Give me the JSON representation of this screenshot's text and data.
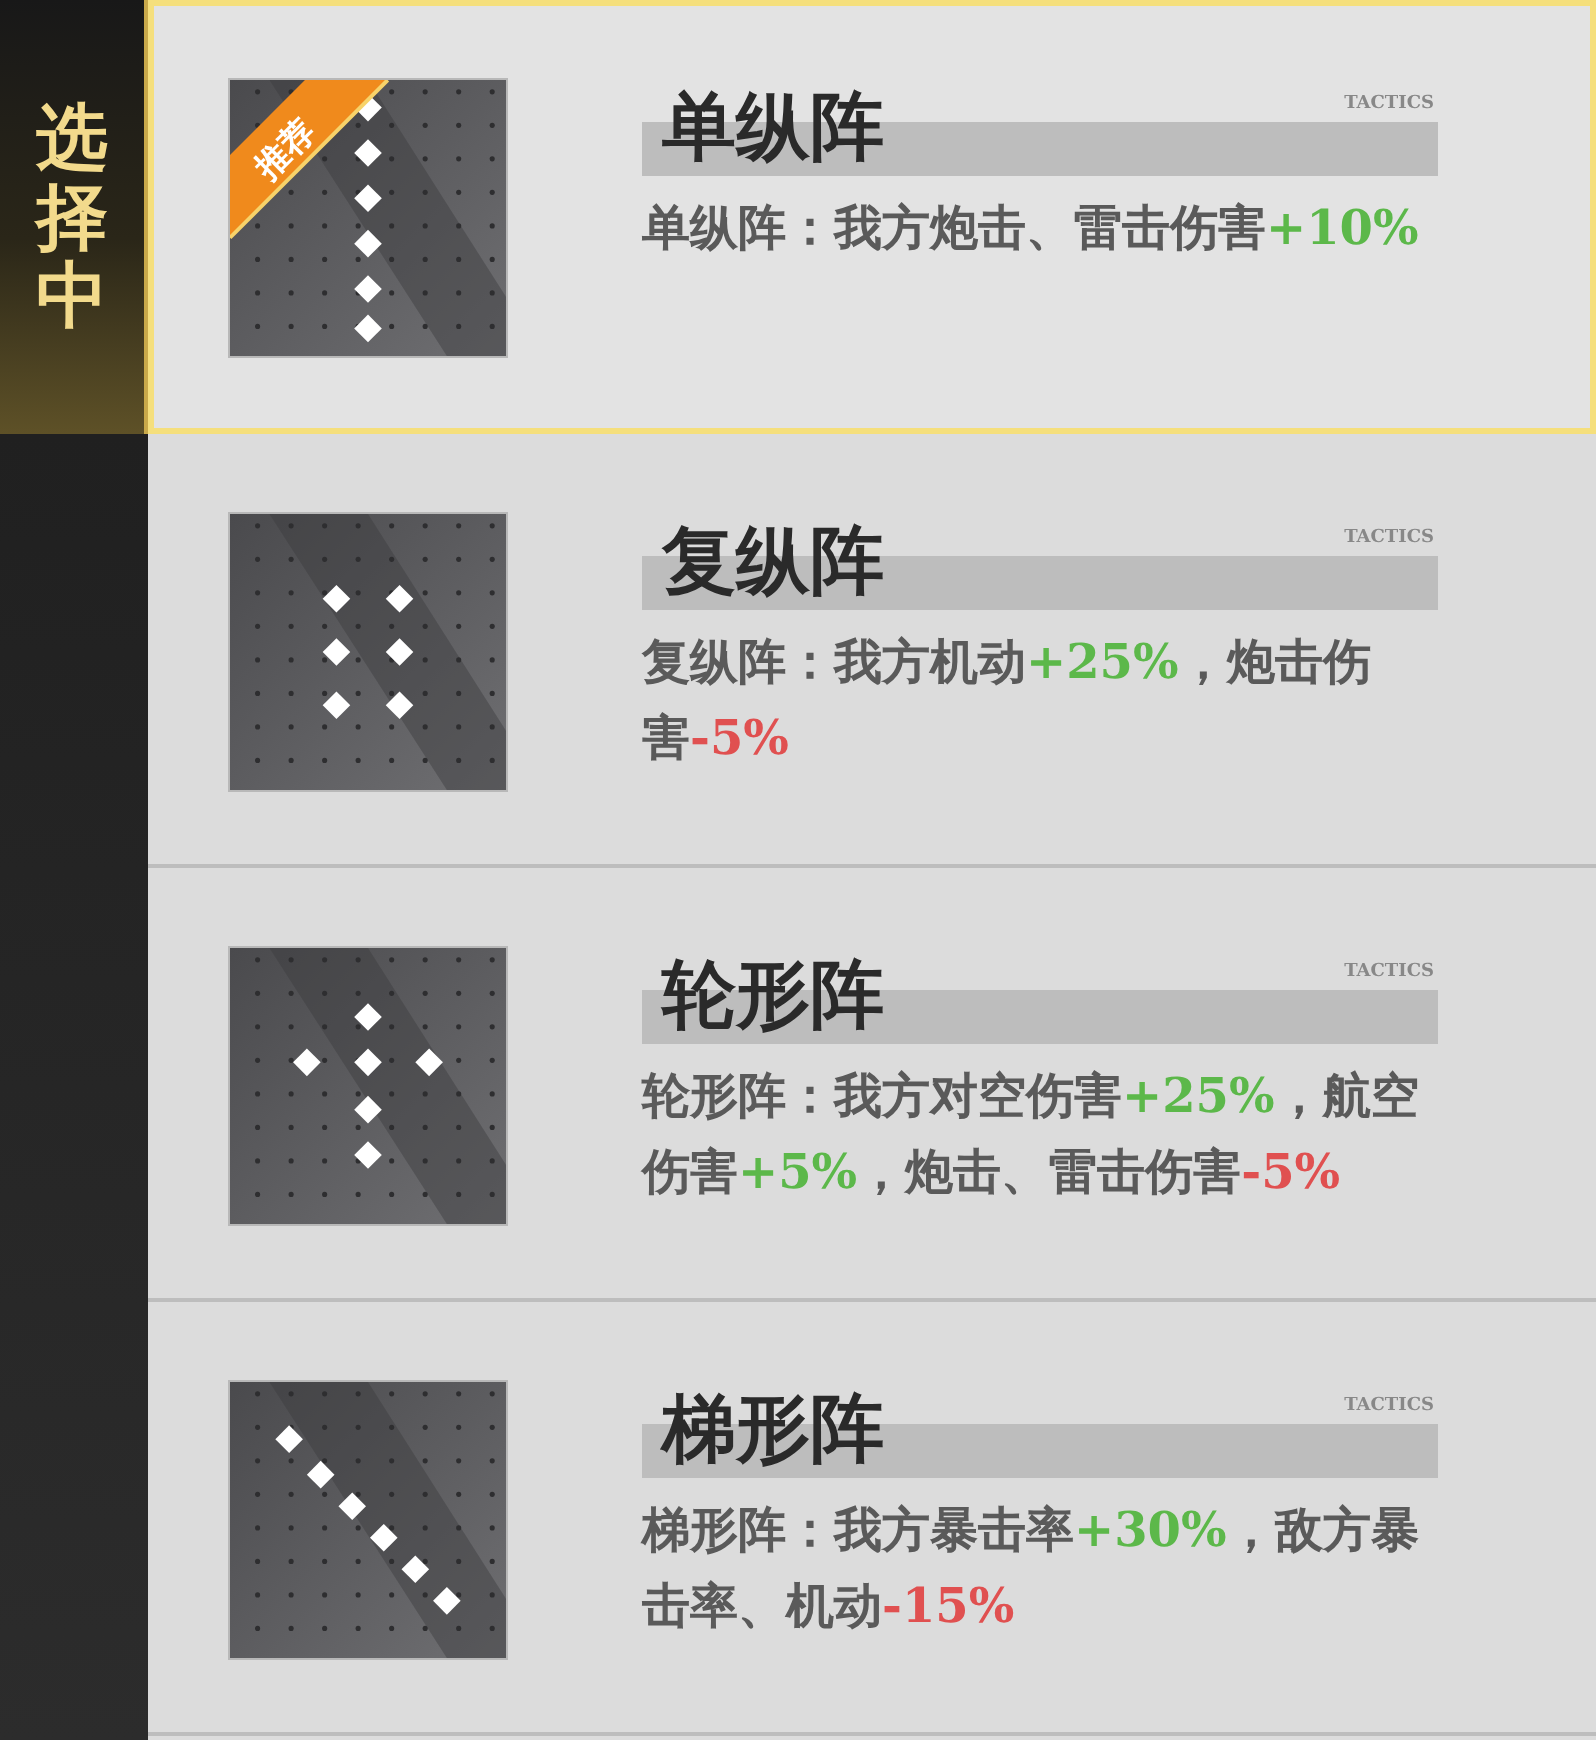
{
  "sidebar": {
    "label": "选择中"
  },
  "formations": [
    {
      "kind": "line",
      "selected": true,
      "badge": "推荐",
      "title": "单纵阵",
      "tag": "TACTICS",
      "description": [
        {
          "text": "单纵阵：我方炮击、雷击伤害"
        },
        {
          "text": "+10%",
          "color": "#5cb84a"
        }
      ]
    },
    {
      "kind": "double",
      "selected": false,
      "title": "复纵阵",
      "tag": "TACTICS",
      "description": [
        {
          "text": "复纵阵：我方机动"
        },
        {
          "text": "+25%",
          "color": "#5cb84a"
        },
        {
          "text": "，炮击伤害"
        },
        {
          "text": "-5%",
          "color": "#e05050"
        }
      ]
    },
    {
      "kind": "ring",
      "selected": false,
      "title": "轮形阵",
      "tag": "TACTICS",
      "description": [
        {
          "text": "轮形阵：我方对空伤害"
        },
        {
          "text": "+25%",
          "color": "#5cb84a"
        },
        {
          "text": "，航空伤害"
        },
        {
          "text": "+5%",
          "color": "#5cb84a"
        },
        {
          "text": "，炮击、雷击伤害"
        },
        {
          "text": "-5%",
          "color": "#e05050"
        }
      ]
    },
    {
      "kind": "echelon",
      "selected": false,
      "title": "梯形阵",
      "tag": "TACTICS",
      "description": [
        {
          "text": "梯形阵：我方暴击率"
        },
        {
          "text": "+30%",
          "color": "#5cb84a"
        },
        {
          "text": "，敌方暴击率、机动"
        },
        {
          "text": "-15%",
          "color": "#e05050"
        }
      ]
    }
  ]
}
